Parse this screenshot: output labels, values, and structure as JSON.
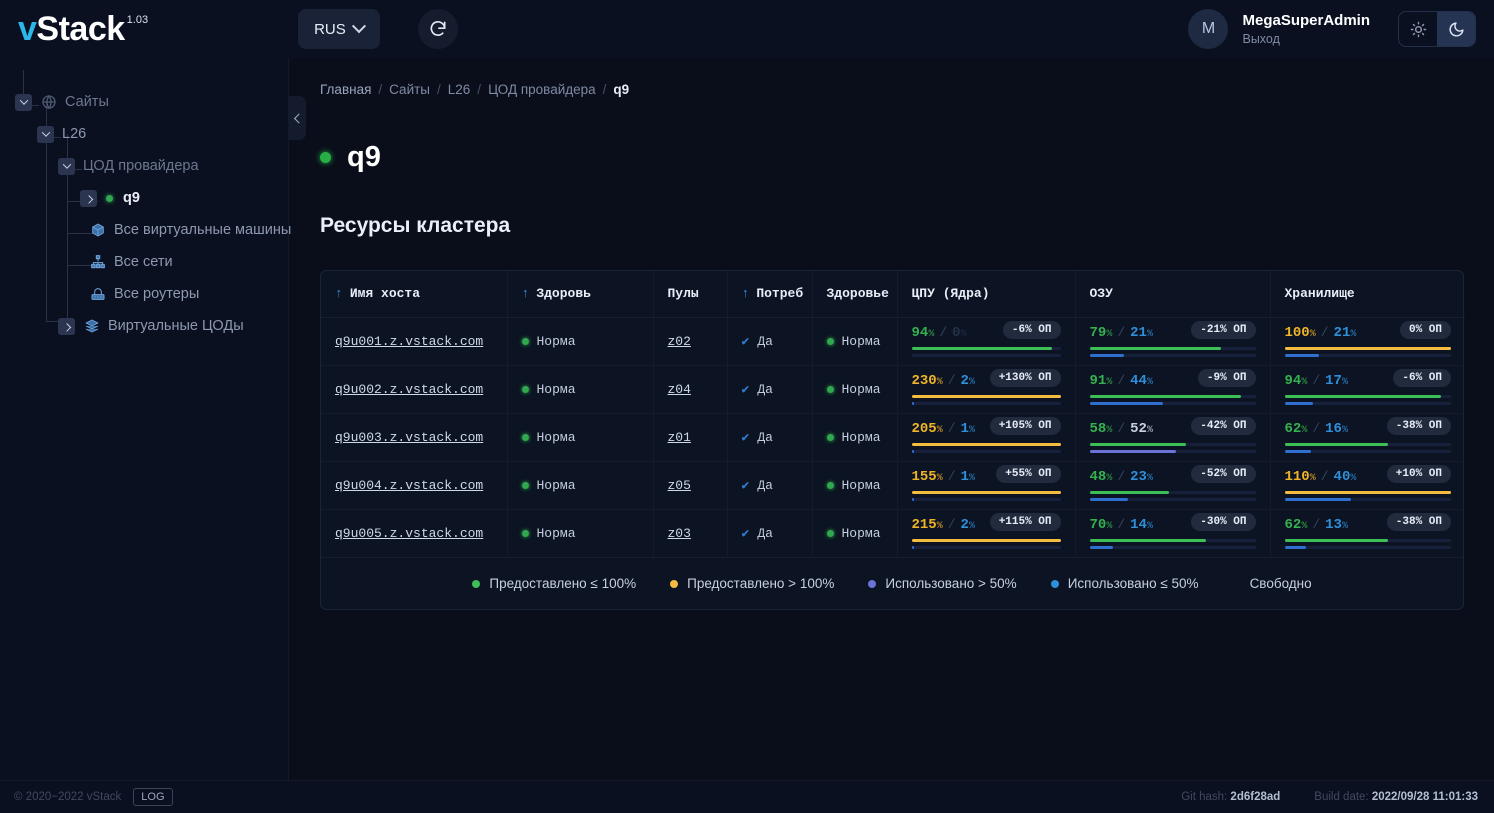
{
  "header": {
    "logo_v": "v",
    "logo_rest": "Stack",
    "version": "1.03",
    "lang_label": "RUS",
    "refresh_icon": "refresh-icon",
    "chevron_icon": "chevron-down-icon",
    "avatar_initial": "M",
    "user_name": "MegaSuperAdmin",
    "logout_label": "Выход",
    "light_icon": "sun-icon",
    "dark_icon": "moon-icon"
  },
  "sidebar": {
    "items": [
      {
        "label": "Сайты",
        "icon": "globe-icon",
        "toggle": "down"
      },
      {
        "label": "L26",
        "icon": "",
        "toggle": "down"
      },
      {
        "label": "ЦОД провайдера",
        "icon": "",
        "toggle": "down"
      },
      {
        "label": "q9",
        "icon": "status-dot-icon",
        "toggle": "right"
      },
      {
        "label": "Все виртуальные машины",
        "icon": "cube-icon",
        "toggle": ""
      },
      {
        "label": "Все сети",
        "icon": "network-icon",
        "toggle": ""
      },
      {
        "label": "Все роутеры",
        "icon": "router-icon",
        "toggle": ""
      },
      {
        "label": "Виртуальные ЦОДы",
        "icon": "layers-icon",
        "toggle": "right"
      }
    ],
    "collapse_icon": "chevron-left-icon"
  },
  "breadcrumb": {
    "items": [
      "Главная",
      "Сайты",
      "L26",
      "ЦОД провайдера"
    ],
    "current": "q9",
    "separator": "/"
  },
  "page": {
    "title": "q9",
    "status_icon": "status-dot-green-icon",
    "section_title": "Ресурсы кластера"
  },
  "table": {
    "columns": [
      {
        "label": "Имя хоста",
        "sortable": true
      },
      {
        "label": "Здоровь",
        "sortable": true
      },
      {
        "label": "Пулы",
        "sortable": false
      },
      {
        "label": "Потреб",
        "sortable": true
      },
      {
        "label": "Здоровье",
        "sortable": false
      },
      {
        "label": "ЦПУ (Ядра)",
        "sortable": false
      },
      {
        "label": "ОЗУ",
        "sortable": false
      },
      {
        "label": "Хранилище",
        "sortable": false
      }
    ],
    "sort_arrow": "↑",
    "check_icon": "check-icon",
    "rows": [
      {
        "host": "q9u001.z.vstack.com",
        "health1": "Норма",
        "pool": "z02",
        "consumed": "Да",
        "health2": "Норма",
        "cpu": {
          "provided": "94",
          "provided_color": "green",
          "used": "0",
          "used_color": "faint",
          "badge": "-6% ОП",
          "bar_provided": 94,
          "bar_provided_color": "green",
          "bar_used": 0,
          "bar_used_color": "blue"
        },
        "ram": {
          "provided": "79",
          "provided_color": "green",
          "used": "21",
          "used_color": "blue",
          "badge": "-21% ОП",
          "bar_provided": 79,
          "bar_provided_color": "green",
          "bar_used": 21,
          "bar_used_color": "blue"
        },
        "storage": {
          "provided": "100",
          "provided_color": "amber",
          "used": "21",
          "used_color": "blue",
          "badge": "0% ОП",
          "bar_provided": 100,
          "bar_provided_color": "amber",
          "bar_used": 21,
          "bar_used_color": "blue"
        }
      },
      {
        "host": "q9u002.z.vstack.com",
        "health1": "Норма",
        "pool": "z04",
        "consumed": "Да",
        "health2": "Норма",
        "cpu": {
          "provided": "230",
          "provided_color": "amber",
          "used": "2",
          "used_color": "blue",
          "badge": "+130% ОП",
          "bar_provided": 100,
          "bar_provided_color": "amber",
          "bar_used": 2,
          "bar_used_color": "blue"
        },
        "ram": {
          "provided": "91",
          "provided_color": "green",
          "used": "44",
          "used_color": "blue",
          "badge": "-9% ОП",
          "bar_provided": 91,
          "bar_provided_color": "green",
          "bar_used": 44,
          "bar_used_color": "blue"
        },
        "storage": {
          "provided": "94",
          "provided_color": "green",
          "used": "17",
          "used_color": "blue",
          "badge": "-6% ОП",
          "bar_provided": 94,
          "bar_provided_color": "green",
          "bar_used": 17,
          "bar_used_color": "blue"
        }
      },
      {
        "host": "q9u003.z.vstack.com",
        "health1": "Норма",
        "pool": "z01",
        "consumed": "Да",
        "health2": "Норма",
        "cpu": {
          "provided": "205",
          "provided_color": "amber",
          "used": "1",
          "used_color": "blue",
          "badge": "+105% ОП",
          "bar_provided": 100,
          "bar_provided_color": "amber",
          "bar_used": 1,
          "bar_used_color": "blue"
        },
        "ram": {
          "provided": "58",
          "provided_color": "green",
          "used": "52",
          "used_color": "indigo",
          "badge": "-42% ОП",
          "bar_provided": 58,
          "bar_provided_color": "green",
          "bar_used": 52,
          "bar_used_color": "indigo"
        },
        "storage": {
          "provided": "62",
          "provided_color": "green",
          "used": "16",
          "used_color": "blue",
          "badge": "-38% ОП",
          "bar_provided": 62,
          "bar_provided_color": "green",
          "bar_used": 16,
          "bar_used_color": "blue"
        }
      },
      {
        "host": "q9u004.z.vstack.com",
        "health1": "Норма",
        "pool": "z05",
        "consumed": "Да",
        "health2": "Норма",
        "cpu": {
          "provided": "155",
          "provided_color": "amber",
          "used": "1",
          "used_color": "blue",
          "badge": "+55% ОП",
          "bar_provided": 100,
          "bar_provided_color": "amber",
          "bar_used": 1,
          "bar_used_color": "blue"
        },
        "ram": {
          "provided": "48",
          "provided_color": "green",
          "used": "23",
          "used_color": "blue",
          "badge": "-52% ОП",
          "bar_provided": 48,
          "bar_provided_color": "green",
          "bar_used": 23,
          "bar_used_color": "blue"
        },
        "storage": {
          "provided": "110",
          "provided_color": "amber",
          "used": "40",
          "used_color": "blue",
          "badge": "+10% ОП",
          "bar_provided": 100,
          "bar_provided_color": "amber",
          "bar_used": 40,
          "bar_used_color": "blue"
        }
      },
      {
        "host": "q9u005.z.vstack.com",
        "health1": "Норма",
        "pool": "z03",
        "consumed": "Да",
        "health2": "Норма",
        "cpu": {
          "provided": "215",
          "provided_color": "amber",
          "used": "2",
          "used_color": "blue",
          "badge": "+115% ОП",
          "bar_provided": 100,
          "bar_provided_color": "amber",
          "bar_used": 2,
          "bar_used_color": "blue"
        },
        "ram": {
          "provided": "70",
          "provided_color": "green",
          "used": "14",
          "used_color": "blue",
          "badge": "-30% ОП",
          "bar_provided": 70,
          "bar_provided_color": "green",
          "bar_used": 14,
          "bar_used_color": "blue"
        },
        "storage": {
          "provided": "62",
          "provided_color": "green",
          "used": "13",
          "used_color": "blue",
          "badge": "-38% ОП",
          "bar_provided": 62,
          "bar_provided_color": "green",
          "bar_used": 13,
          "bar_used_color": "blue"
        }
      }
    ],
    "legend": [
      {
        "label": "Предоставлено ≤ 100%",
        "color": "#3cbf55"
      },
      {
        "label": "Предоставлено > 100%",
        "color": "#f4bd3f"
      },
      {
        "label": "Использовано > 50%",
        "color": "#6b72d8"
      },
      {
        "label": "Использовано ≤ 50%",
        "color": "#2f8fd8"
      },
      {
        "label": "Свободно",
        "color": "#2a3category"
      }
    ]
  },
  "footer": {
    "copyright": "© 2020−2022 vStack",
    "log_label": "LOG",
    "git_hash_label": "Git hash:",
    "git_hash_value": "2d6f28ad",
    "build_date_label": "Build date:",
    "build_date_value": "2022/09/28 11:01:33"
  },
  "colors": {
    "green": "#3cbf55",
    "amber": "#f4bd3f",
    "blue": "#2f8fd8",
    "indigo": "#6b72d8",
    "free": "#233048"
  }
}
